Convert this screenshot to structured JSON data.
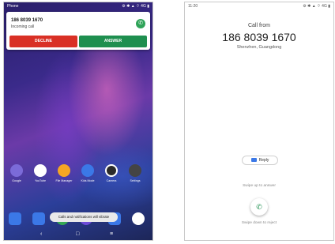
{
  "left_screen": {
    "status": {
      "app_label": "Phone",
      "icons": "⚙ ✱ ▲ ⌔ 4G ▮"
    },
    "notification": {
      "caller_number": "186 8039 1670",
      "subtitle": "Incoming call",
      "decline_label": "DECLINE",
      "answer_label": "ANSWER",
      "answer_icon": "phone-icon"
    },
    "apps": [
      {
        "label": "Google",
        "color": "#7b6bd8"
      },
      {
        "label": "YouTube",
        "color": "#ffffff"
      },
      {
        "label": "File Manager",
        "color": "#f5a623"
      },
      {
        "label": "Kids Mode",
        "color": "#3b78e7"
      },
      {
        "label": "Camera",
        "color": "#2b2b2b"
      },
      {
        "label": "Settings",
        "color": "#444444"
      }
    ],
    "dock_colors": [
      "#3b78e7",
      "#3b78e7",
      "#36a853",
      "#6d4bd8",
      "#3b78e7",
      "#ffffff"
    ],
    "toast": "Calls and notifications will vibrate",
    "nav": {
      "back": "‹",
      "home": "□",
      "recent": "≡"
    }
  },
  "right_screen": {
    "status": {
      "time": "11:20",
      "icons": "⚙ ✱ ▲ ⌔ 4G ▮"
    },
    "call_from": "Call from",
    "caller_number": "186 8039 1670",
    "location": "Shenzhen, Guangdong",
    "reply_label": "Reply",
    "swipe_up": "Swipe up to answer",
    "swipe_down": "Swipe down to reject"
  }
}
